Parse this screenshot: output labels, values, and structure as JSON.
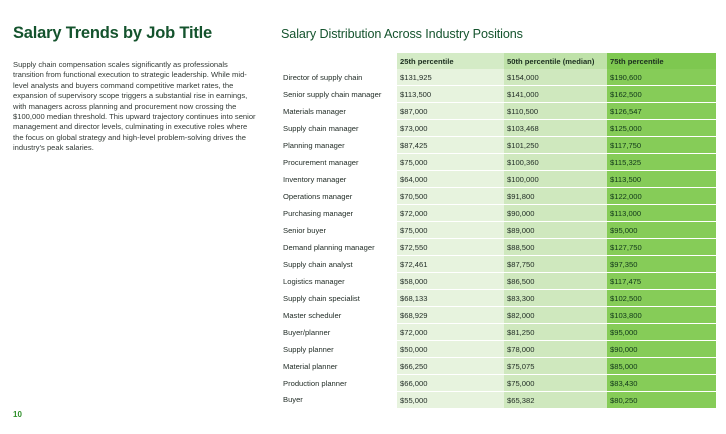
{
  "left": {
    "title": "Salary Trends by Job Title",
    "body": "Supply chain compensation scales significantly as professionals transition from functional execution to strategic leadership. While mid-level analysts and buyers command competitive market rates, the expansion of supervisory scope triggers a substantial rise in earnings, with managers across planning and procurement now crossing the $100,000 median threshold. This upward trajectory continues into senior management and director levels, culminating in executive roles where the focus on global strategy and high-level problem-solving drives the industry's peak salaries.",
    "page_number": "10"
  },
  "right": {
    "title": "Salary Distribution Across Industry Positions"
  },
  "chart_data": {
    "type": "table",
    "title": "Salary Distribution Across Industry Positions",
    "columns": [
      "",
      "25th percentile",
      "50th percentile (median)",
      "75th percentile"
    ],
    "rows": [
      [
        "Director of supply chain",
        "$131,925",
        "$154,000",
        "$190,600"
      ],
      [
        "Senior supply chain manager",
        "$113,500",
        "$141,000",
        "$162,500"
      ],
      [
        "Materials manager",
        "$87,000",
        "$110,500",
        "$126,547"
      ],
      [
        "Supply chain manager",
        "$73,000",
        "$103,468",
        "$125,000"
      ],
      [
        "Planning manager",
        "$87,425",
        "$101,250",
        "$117,750"
      ],
      [
        "Procurement manager",
        "$75,000",
        "$100,360",
        "$115,325"
      ],
      [
        "Inventory manager",
        "$64,000",
        "$100,000",
        "$113,500"
      ],
      [
        "Operations manager",
        "$70,500",
        "$91,800",
        "$122,000"
      ],
      [
        "Purchasing manager",
        "$72,000",
        "$90,000",
        "$113,000"
      ],
      [
        "Senior buyer",
        "$75,000",
        "$89,000",
        "$95,000"
      ],
      [
        "Demand planning manager",
        "$72,550",
        "$88,500",
        "$127,750"
      ],
      [
        "Supply chain analyst",
        "$72,461",
        "$87,750",
        "$97,350"
      ],
      [
        "Logistics manager",
        "$58,000",
        "$86,500",
        "$117,475"
      ],
      [
        "Supply chain specialist",
        "$68,133",
        "$83,300",
        "$102,500"
      ],
      [
        "Master scheduler",
        "$68,929",
        "$82,000",
        "$103,800"
      ],
      [
        "Buyer/planner",
        "$72,000",
        "$81,250",
        "$95,000"
      ],
      [
        "Supply planner",
        "$50,000",
        "$78,000",
        "$90,000"
      ],
      [
        "Material planner",
        "$66,250",
        "$75,075",
        "$85,000"
      ],
      [
        "Production planner",
        "$66,000",
        "$75,000",
        "$83,430"
      ],
      [
        "Buyer",
        "$55,000",
        "$65,382",
        "$80,250"
      ]
    ]
  }
}
